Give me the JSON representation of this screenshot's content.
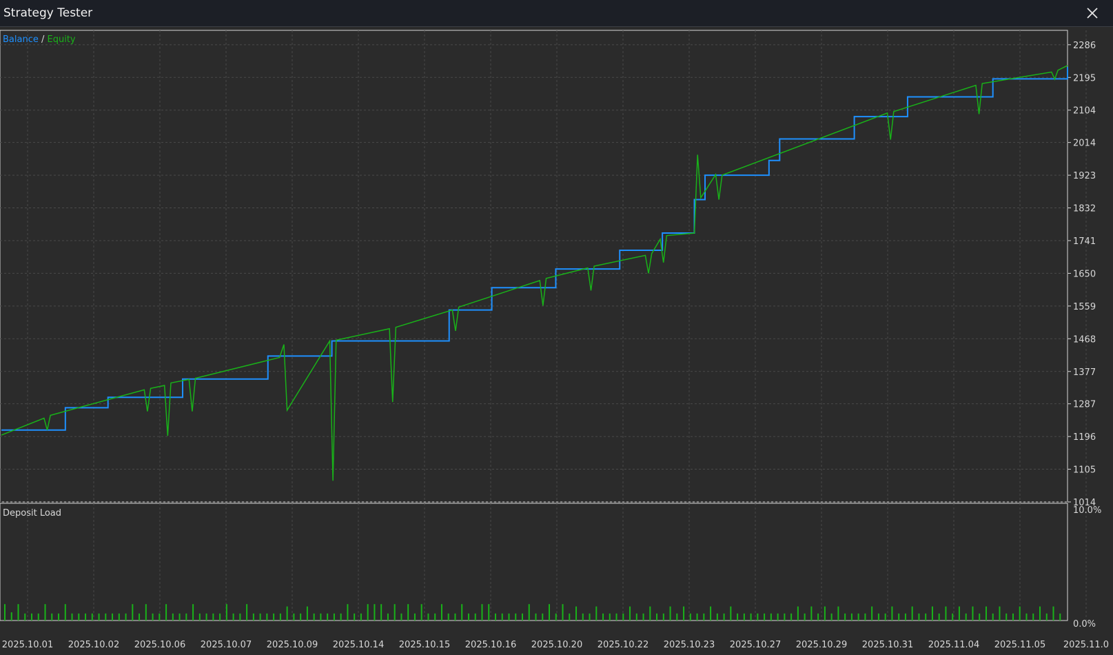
{
  "window": {
    "title": "Strategy Tester",
    "close_icon": "close-icon"
  },
  "colors": {
    "balance": "#1e90ff",
    "equity": "#19b219",
    "deposit_load": "#19b219",
    "background": "#2b2b2b",
    "grid": "#4a4a4a",
    "axis_text": "#d8d8d8"
  },
  "chart_data": [
    {
      "type": "line",
      "legend_balance": "Balance",
      "legend_separator": " / ",
      "legend_equity": "Equity",
      "legend_placement": "top-left",
      "grid": true,
      "ylim": [
        1014,
        2326
      ],
      "y_ticks": [
        1014,
        1105,
        1196,
        1287,
        1377,
        1468,
        1559,
        1650,
        1741,
        1832,
        1923,
        2014,
        2104,
        2195,
        2286
      ],
      "x_ticks": [
        "2025.10.01",
        "2025.10.02",
        "2025.10.06",
        "2025.10.07",
        "2025.10.09",
        "2025.10.14",
        "2025.10.15",
        "2025.10.16",
        "2025.10.20",
        "2025.10.22",
        "2025.10.23",
        "2025.10.27",
        "2025.10.29",
        "2025.10.31",
        "2025.11.04",
        "2025.11.05",
        "2025.11.0"
      ],
      "x_range": [
        0,
        100
      ],
      "series": [
        {
          "name": "Balance",
          "x": [
            0,
            6,
            10,
            17,
            25,
            31,
            42,
            46,
            52,
            58,
            62,
            65,
            66,
            72,
            73,
            80,
            85,
            93,
            100
          ],
          "y": [
            1214,
            1276,
            1305,
            1356,
            1420,
            1462,
            1548,
            1610,
            1662,
            1714,
            1762,
            1855,
            1923,
            1964,
            2024,
            2086,
            2141,
            2191,
            2224
          ]
        },
        {
          "name": "Equity",
          "x": [
            0,
            4,
            4.3,
            4.6,
            13.4,
            13.7,
            14,
            15.3,
            15.6,
            15.9,
            17.6,
            17.9,
            18.2,
            26.1,
            26.5,
            26.8,
            30.8,
            31.1,
            31.4,
            36.4,
            36.7,
            37,
            42.3,
            42.6,
            42.9,
            50.5,
            50.8,
            51.1,
            55,
            55.3,
            55.6,
            60.4,
            60.7,
            61,
            61.8,
            62.1,
            62.4,
            65,
            65.3,
            65.6,
            67,
            67.3,
            67.6,
            83.1,
            83.4,
            83.7,
            91.4,
            91.7,
            92,
            98.5,
            98.8,
            99.1,
            100
          ],
          "y": [
            1200,
            1247,
            1214,
            1255,
            1326,
            1266,
            1330,
            1338,
            1198,
            1345,
            1355,
            1266,
            1358,
            1416,
            1452,
            1269,
            1462,
            1073,
            1464,
            1496,
            1292,
            1500,
            1548,
            1490,
            1556,
            1630,
            1560,
            1636,
            1665,
            1602,
            1670,
            1700,
            1650,
            1705,
            1745,
            1680,
            1755,
            1762,
            1980,
            1860,
            1925,
            1855,
            1923,
            2096,
            2022,
            2100,
            2173,
            2093,
            2178,
            2210,
            2190,
            2215,
            2228
          ]
        }
      ]
    },
    {
      "type": "bar",
      "title": "Deposit Load",
      "ylim": [
        0,
        10
      ],
      "y_ticks": [
        "10.0%",
        "0.0%"
      ],
      "values": [
        1.4,
        0.7,
        1.4,
        0.6,
        0.6,
        0.6,
        1.4,
        0.6,
        0.6,
        1.4,
        0.6,
        0.6,
        0.6,
        0.6,
        0.6,
        0.6,
        0.6,
        0.6,
        0.6,
        1.4,
        0.6,
        1.4,
        0.6,
        0.6,
        1.4,
        0.6,
        0.6,
        0.6,
        1.4,
        0.6,
        0.6,
        0.6,
        0.6,
        1.4,
        0.6,
        0.6,
        1.4,
        0.6,
        0.6,
        0.6,
        0.6,
        0.6,
        1.2,
        0.6,
        0.6,
        1.2,
        0.6,
        0.6,
        0.6,
        0.6,
        0.6,
        1.4,
        0.6,
        0.6,
        1.4,
        1.4,
        1.4,
        0.6,
        1.4,
        0.6,
        1.4,
        0.6,
        1.4,
        0.6,
        0.6,
        1.4,
        0.6,
        0.6,
        1.4,
        0.6,
        0.6,
        1.4,
        1.4,
        0.6,
        0.6,
        0.6,
        0.6,
        0.6,
        1.4,
        0.6,
        0.6,
        1.4,
        0.6,
        1.4,
        0.6,
        1.2,
        0.6,
        0.6,
        1.2,
        0.6,
        0.6,
        0.6,
        0.6,
        1.2,
        0.6,
        0.6,
        1.2,
        0.6,
        0.6,
        1.2,
        0.6,
        1.2,
        0.6,
        0.6,
        0.6,
        1.2,
        0.6,
        0.6,
        1.2,
        0.6,
        0.6,
        0.6,
        0.6,
        0.6,
        0.6,
        0.6,
        0.6,
        0.6,
        1.2,
        0.6,
        1.2,
        0.6,
        1.2,
        0.6,
        1.2,
        0.6,
        0.6,
        0.6,
        0.6,
        1.2,
        0.6,
        0.6,
        1.2,
        0.6,
        0.6,
        1.2,
        0.6,
        0.6,
        1.2,
        0.6,
        1.2,
        0.6,
        1.2,
        0.6,
        1.2,
        0.6,
        1.2,
        0.6,
        1.2,
        0.6,
        0.6,
        1.2,
        0.6,
        0.6,
        1.2,
        0.6,
        1.2,
        0.6
      ]
    }
  ]
}
